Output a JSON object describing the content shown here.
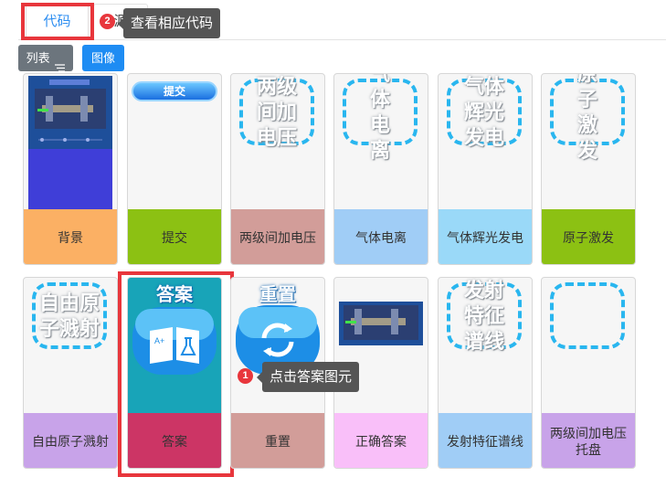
{
  "tabs": [
    {
      "label": "代码"
    },
    {
      "label": "源"
    }
  ],
  "steps": [
    {
      "number": "2",
      "text": "查看相应代码"
    },
    {
      "number": "1",
      "text": "点击答案图元"
    }
  ],
  "view_buttons": {
    "list": "列表",
    "list_icon": "list-icon",
    "image": "图像"
  },
  "cards_row1": [
    {
      "label": "背景",
      "thumb": "background-screenshot",
      "color": "#fbb064"
    },
    {
      "label": "提交",
      "thumb": "submit-button",
      "thumb_text": "提交",
      "color": "#8cc113"
    },
    {
      "label": "两级间加电压",
      "thumb": "dashed-text",
      "thumb_text": "两级间加电压",
      "color": "#d29d99"
    },
    {
      "label": "气体电离",
      "thumb": "dashed-text",
      "thumb_text": "气体电离",
      "color": "#a0cdf6"
    },
    {
      "label": "气体辉光发电",
      "thumb": "dashed-text",
      "thumb_text": "气体辉光发电",
      "color": "#9ad9f8"
    },
    {
      "label": "原子激发",
      "thumb": "dashed-text",
      "thumb_text": "原子激发",
      "color": "#8cc113"
    }
  ],
  "cards_row2": [
    {
      "label": "自由原子溅射",
      "thumb": "dashed-text",
      "thumb_text": "自由原子溅射",
      "color": "#c8a3e9"
    },
    {
      "label": "答案",
      "thumb": "answer-icon",
      "thumb_text": "答案",
      "color": "#cc3565"
    },
    {
      "label": "重置",
      "thumb": "reset-icon",
      "thumb_text": "重置",
      "color": "#d29d99"
    },
    {
      "label": "正确答案",
      "thumb": "answer-screenshot",
      "color": "#f9bff9"
    },
    {
      "label": "发射特征谱线",
      "thumb": "dashed-text",
      "thumb_text": "发射特征谱线",
      "color": "#a0cdf6"
    },
    {
      "label": "两级间加电压托盘",
      "thumb": "empty-dashed",
      "color": "#c8a3e9"
    }
  ]
}
